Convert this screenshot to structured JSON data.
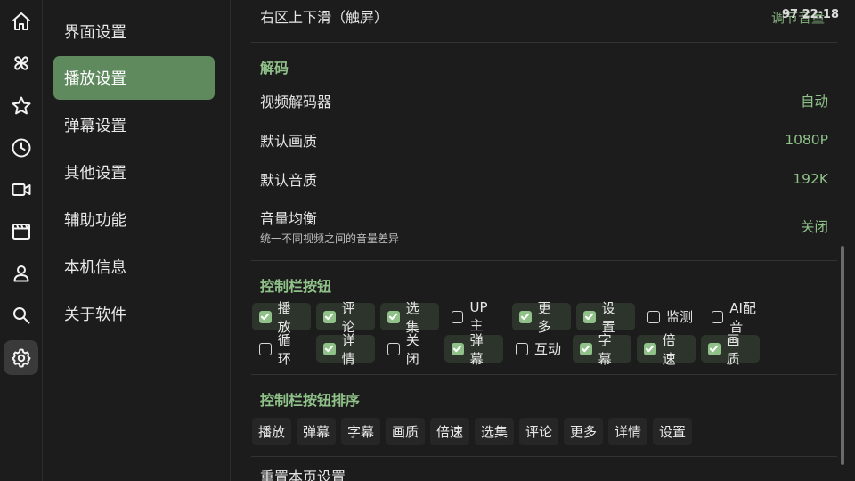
{
  "rail": {
    "icons": [
      "home-icon",
      "pinwheel-icon",
      "star-icon",
      "clock-icon",
      "video-camera-icon",
      "film-icon",
      "person-icon",
      "search-icon",
      "gear-icon"
    ]
  },
  "menu": {
    "items": [
      {
        "label": "界面设置"
      },
      {
        "label": "播放设置"
      },
      {
        "label": "弹幕设置"
      },
      {
        "label": "其他设置"
      },
      {
        "label": "辅助功能"
      },
      {
        "label": "本机信息"
      },
      {
        "label": "关于软件"
      }
    ],
    "active_index": 1
  },
  "status": {
    "time": "97 22:18"
  },
  "content": {
    "top_row": {
      "label": "右区上下滑（触屏）",
      "value": "调节音量"
    },
    "decode": {
      "title": "解码",
      "rows": [
        {
          "label": "视频解码器",
          "value": "自动"
        },
        {
          "label": "默认画质",
          "value": "1080P"
        },
        {
          "label": "默认音质",
          "value": "192K"
        },
        {
          "label": "音量均衡",
          "sub": "统一不同视频之间的音量差异",
          "value": "关闭"
        }
      ]
    },
    "controls": {
      "title": "控制栏按钮",
      "buttons": [
        {
          "label": "播放",
          "checked": true
        },
        {
          "label": "评论",
          "checked": true
        },
        {
          "label": "选集",
          "checked": true
        },
        {
          "label": "UP主",
          "checked": false
        },
        {
          "label": "更多",
          "checked": true
        },
        {
          "label": "设置",
          "checked": true
        },
        {
          "label": "监测",
          "checked": false
        },
        {
          "label": "AI配音",
          "checked": false
        },
        {
          "label": "循环",
          "checked": false
        },
        {
          "label": "详情",
          "checked": true
        },
        {
          "label": "关闭",
          "checked": false
        },
        {
          "label": "弹幕",
          "checked": true
        },
        {
          "label": "互动",
          "checked": false
        },
        {
          "label": "字幕",
          "checked": true
        },
        {
          "label": "倍速",
          "checked": true
        },
        {
          "label": "画质",
          "checked": true
        }
      ]
    },
    "sort": {
      "title": "控制栏按钮排序",
      "items": [
        "播放",
        "弹幕",
        "字幕",
        "画质",
        "倍速",
        "选集",
        "评论",
        "更多",
        "详情",
        "设置"
      ]
    },
    "reset": {
      "label": "重置本页设置"
    }
  },
  "colors": {
    "accent": "#8fc189",
    "active_menu": "#5f8a5e",
    "background": "#1c1c1c"
  }
}
